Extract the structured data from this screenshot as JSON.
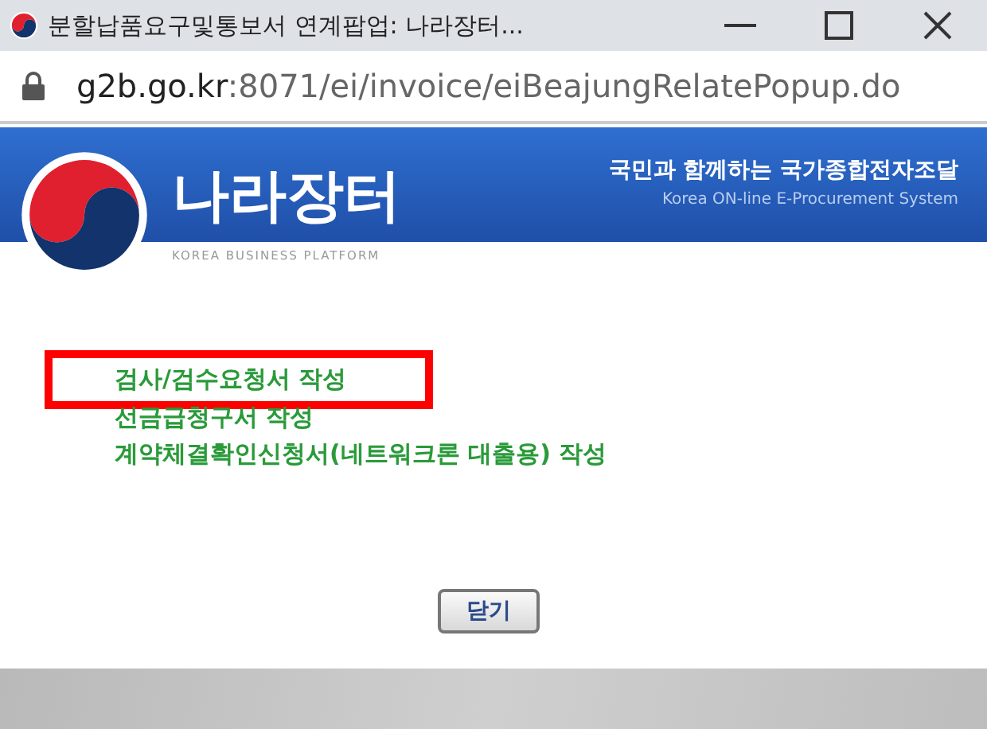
{
  "window": {
    "title": "분할납품요구및통보서 연계팝업: 나라장터..."
  },
  "address_bar": {
    "host": "g2b.go.kr",
    "path": ":8071/ei/invoice/eiBeajungRelatePopup.do"
  },
  "banner": {
    "logo_text": "나라장터",
    "logo_subtitle": "KOREA BUSINESS PLATFORM",
    "slogan": "국민과 함께하는 국가종합전자조달",
    "slogan_english": "Korea ON-line E-Procurement System"
  },
  "links": [
    {
      "label": "검사/검수요청서 작성",
      "highlighted": true
    },
    {
      "label": "선금급청구서 작성",
      "highlighted": false
    },
    {
      "label": "계약체결확인신청서(네트워크론 대출용) 작성",
      "highlighted": false
    }
  ],
  "buttons": [
    "닫기"
  ]
}
